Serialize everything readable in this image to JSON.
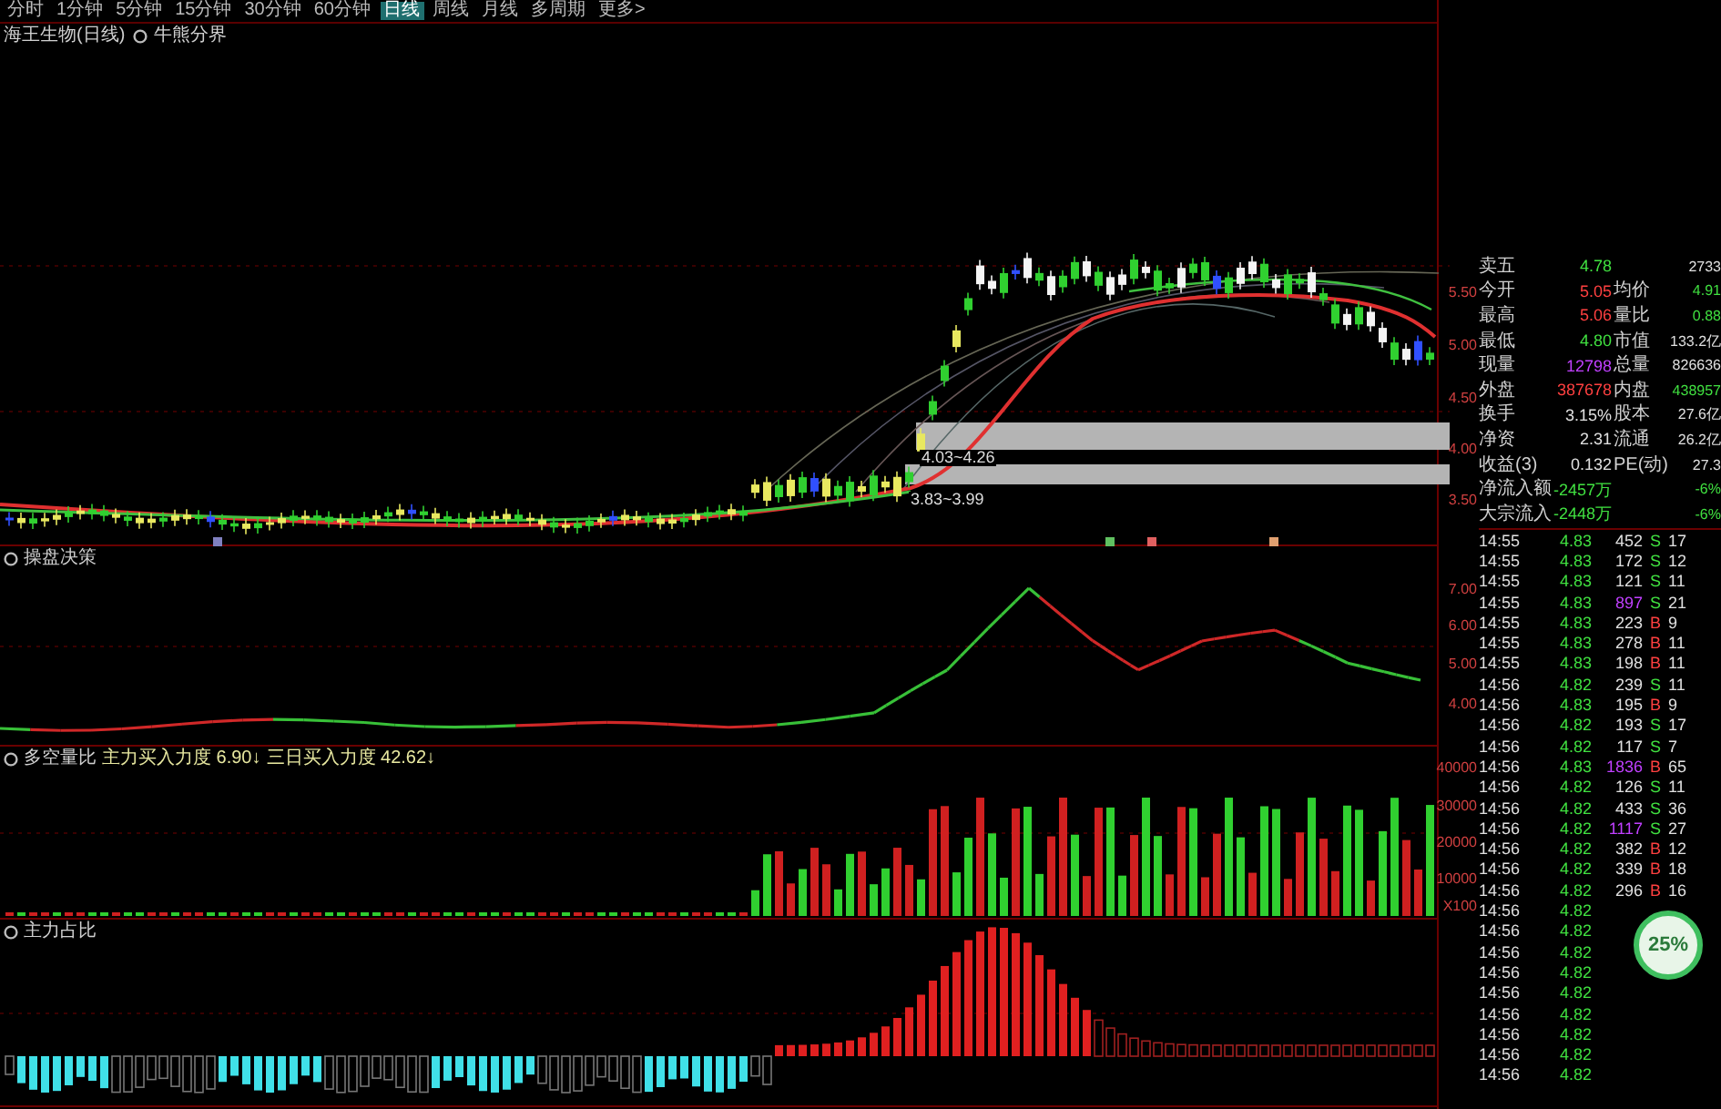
{
  "toolbar": [
    {
      "label": "分时",
      "selected": false
    },
    {
      "label": "1分钟",
      "selected": false
    },
    {
      "label": "5分钟",
      "selected": false
    },
    {
      "label": "15分钟",
      "selected": false
    },
    {
      "label": "30分钟",
      "selected": false
    },
    {
      "label": "60分钟",
      "selected": false
    },
    {
      "label": "日线",
      "selected": true
    },
    {
      "label": "周线",
      "selected": false
    },
    {
      "label": "月线",
      "selected": false
    },
    {
      "label": "多周期",
      "selected": false
    },
    {
      "label": "更多>",
      "selected": false
    }
  ],
  "main_panel": {
    "title": "海王生物(日线)",
    "indicator": "牛熊分界",
    "zones": [
      "4.03~4.26",
      "3.83~3.99"
    ],
    "axis": [
      "5.50",
      "5.00",
      "4.50",
      "4.00",
      "3.50"
    ]
  },
  "panels": [
    {
      "kind": "line",
      "labels": [
        "操盘决策"
      ],
      "axis": [
        "7.00",
        "6.00",
        "5.00",
        "4.00"
      ]
    },
    {
      "kind": "volume",
      "labels": [
        "多空量比",
        "主力买入力度 6.90↓",
        "三日买入力度 42.62↓"
      ],
      "axis": [
        "40000",
        "30000",
        "20000",
        "10000",
        "X100"
      ]
    },
    {
      "kind": "ratio",
      "labels": [
        "主力占比"
      ]
    }
  ],
  "quote": [
    {
      "items": [
        {
          "label": "卖五",
          "value": "4.78",
          "color": "#40e040"
        },
        {
          "value": "2733",
          "color": "#e0e0e0"
        }
      ]
    },
    {
      "items": [
        {
          "label": "今开",
          "value": "5.05",
          "color": "#ff4040"
        },
        {
          "label": "均价",
          "value": "4.91",
          "color": "#40e040"
        }
      ]
    },
    {
      "items": [
        {
          "label": "最高",
          "value": "5.06",
          "color": "#ff4040"
        },
        {
          "label": "量比",
          "value": "0.88",
          "color": "#40e040"
        }
      ]
    },
    {
      "items": [
        {
          "label": "最低",
          "value": "4.80",
          "color": "#40e040"
        },
        {
          "label": "市值",
          "value": "133.2亿",
          "color": "#e0e0e0"
        }
      ]
    },
    {
      "items": [
        {
          "label": "现量",
          "value": "12798",
          "color": "#c040ff"
        },
        {
          "label": "总量",
          "value": "826636",
          "color": "#e0e0e0"
        }
      ]
    },
    {
      "items": [
        {
          "label": "外盘",
          "value": "387678",
          "color": "#ff4040"
        },
        {
          "label": "内盘",
          "value": "438957",
          "color": "#40e040"
        }
      ]
    },
    {
      "items": [
        {
          "label": "换手",
          "value": "3.15%",
          "color": "#e0e0e0"
        },
        {
          "label": "股本",
          "value": "27.6亿",
          "color": "#e0e0e0"
        }
      ]
    },
    {
      "items": [
        {
          "label": "净资",
          "value": "2.31",
          "color": "#e0e0e0"
        },
        {
          "label": "流通",
          "value": "26.2亿",
          "color": "#e0e0e0"
        }
      ]
    },
    {
      "items": [
        {
          "label": "收益(3)",
          "value": "0.132",
          "color": "#e0e0e0"
        },
        {
          "label": "PE(动)",
          "value": "27.3",
          "color": "#e0e0e0"
        }
      ]
    },
    {
      "items": [
        {
          "label": "净流入额",
          "value": "-2457万",
          "color": "#40e040"
        },
        {
          "value": "-6%",
          "color": "#40e040"
        }
      ]
    },
    {
      "items": [
        {
          "label": "大宗流入",
          "value": "-2448万",
          "color": "#40e040"
        },
        {
          "value": "-6%",
          "color": "#40e040"
        }
      ]
    }
  ],
  "ticks": [
    {
      "time": "14:55",
      "price": "4.83",
      "volume": "452",
      "large": false,
      "side": "S",
      "buy": false,
      "count": "17"
    },
    {
      "time": "14:55",
      "price": "4.83",
      "volume": "172",
      "large": false,
      "side": "S",
      "buy": false,
      "count": "12"
    },
    {
      "time": "14:55",
      "price": "4.83",
      "volume": "121",
      "large": false,
      "side": "S",
      "buy": false,
      "count": "11"
    },
    {
      "time": "14:55",
      "price": "4.83",
      "volume": "897",
      "large": true,
      "side": "S",
      "buy": false,
      "count": "21"
    },
    {
      "time": "14:55",
      "price": "4.83",
      "volume": "223",
      "large": false,
      "side": "B",
      "buy": true,
      "count": "9"
    },
    {
      "time": "14:55",
      "price": "4.83",
      "volume": "278",
      "large": false,
      "side": "B",
      "buy": true,
      "count": "11"
    },
    {
      "time": "14:55",
      "price": "4.83",
      "volume": "198",
      "large": false,
      "side": "B",
      "buy": true,
      "count": "11"
    },
    {
      "time": "14:56",
      "price": "4.82",
      "volume": "239",
      "large": false,
      "side": "S",
      "buy": false,
      "count": "11"
    },
    {
      "time": "14:56",
      "price": "4.83",
      "volume": "195",
      "large": false,
      "side": "B",
      "buy": true,
      "count": "9"
    },
    {
      "time": "14:56",
      "price": "4.82",
      "volume": "193",
      "large": false,
      "side": "S",
      "buy": false,
      "count": "17"
    },
    {
      "time": "14:56",
      "price": "4.82",
      "volume": "117",
      "large": false,
      "side": "S",
      "buy": false,
      "count": "7"
    },
    {
      "time": "14:56",
      "price": "4.83",
      "volume": "1836",
      "large": true,
      "side": "B",
      "buy": true,
      "count": "65"
    },
    {
      "time": "14:56",
      "price": "4.82",
      "volume": "126",
      "large": false,
      "side": "S",
      "buy": false,
      "count": "11"
    },
    {
      "time": "14:56",
      "price": "4.82",
      "volume": "433",
      "large": false,
      "side": "S",
      "buy": false,
      "count": "36"
    },
    {
      "time": "14:56",
      "price": "4.82",
      "volume": "1117",
      "large": true,
      "side": "S",
      "buy": false,
      "count": "27"
    },
    {
      "time": "14:56",
      "price": "4.82",
      "volume": "382",
      "large": false,
      "side": "B",
      "buy": true,
      "count": "12"
    },
    {
      "time": "14:56",
      "price": "4.82",
      "volume": "339",
      "large": false,
      "side": "B",
      "buy": true,
      "count": "18"
    },
    {
      "time": "14:56",
      "price": "4.82",
      "volume": "296",
      "large": false,
      "side": "B",
      "buy": true,
      "count": "16"
    },
    {
      "time": "14:56",
      "price": "4.82"
    },
    {
      "time": "14:56",
      "price": "4.82"
    },
    {
      "time": "14:56",
      "price": "4.82"
    },
    {
      "time": "14:56",
      "price": "4.82"
    },
    {
      "time": "14:56",
      "price": "4.82"
    },
    {
      "time": "14:56",
      "price": "4.82"
    },
    {
      "time": "14:56",
      "price": "4.82"
    },
    {
      "time": "14:56",
      "price": "4.82"
    },
    {
      "time": "14:56",
      "price": "4.82"
    }
  ],
  "badge": {
    "text": "25%"
  }
}
